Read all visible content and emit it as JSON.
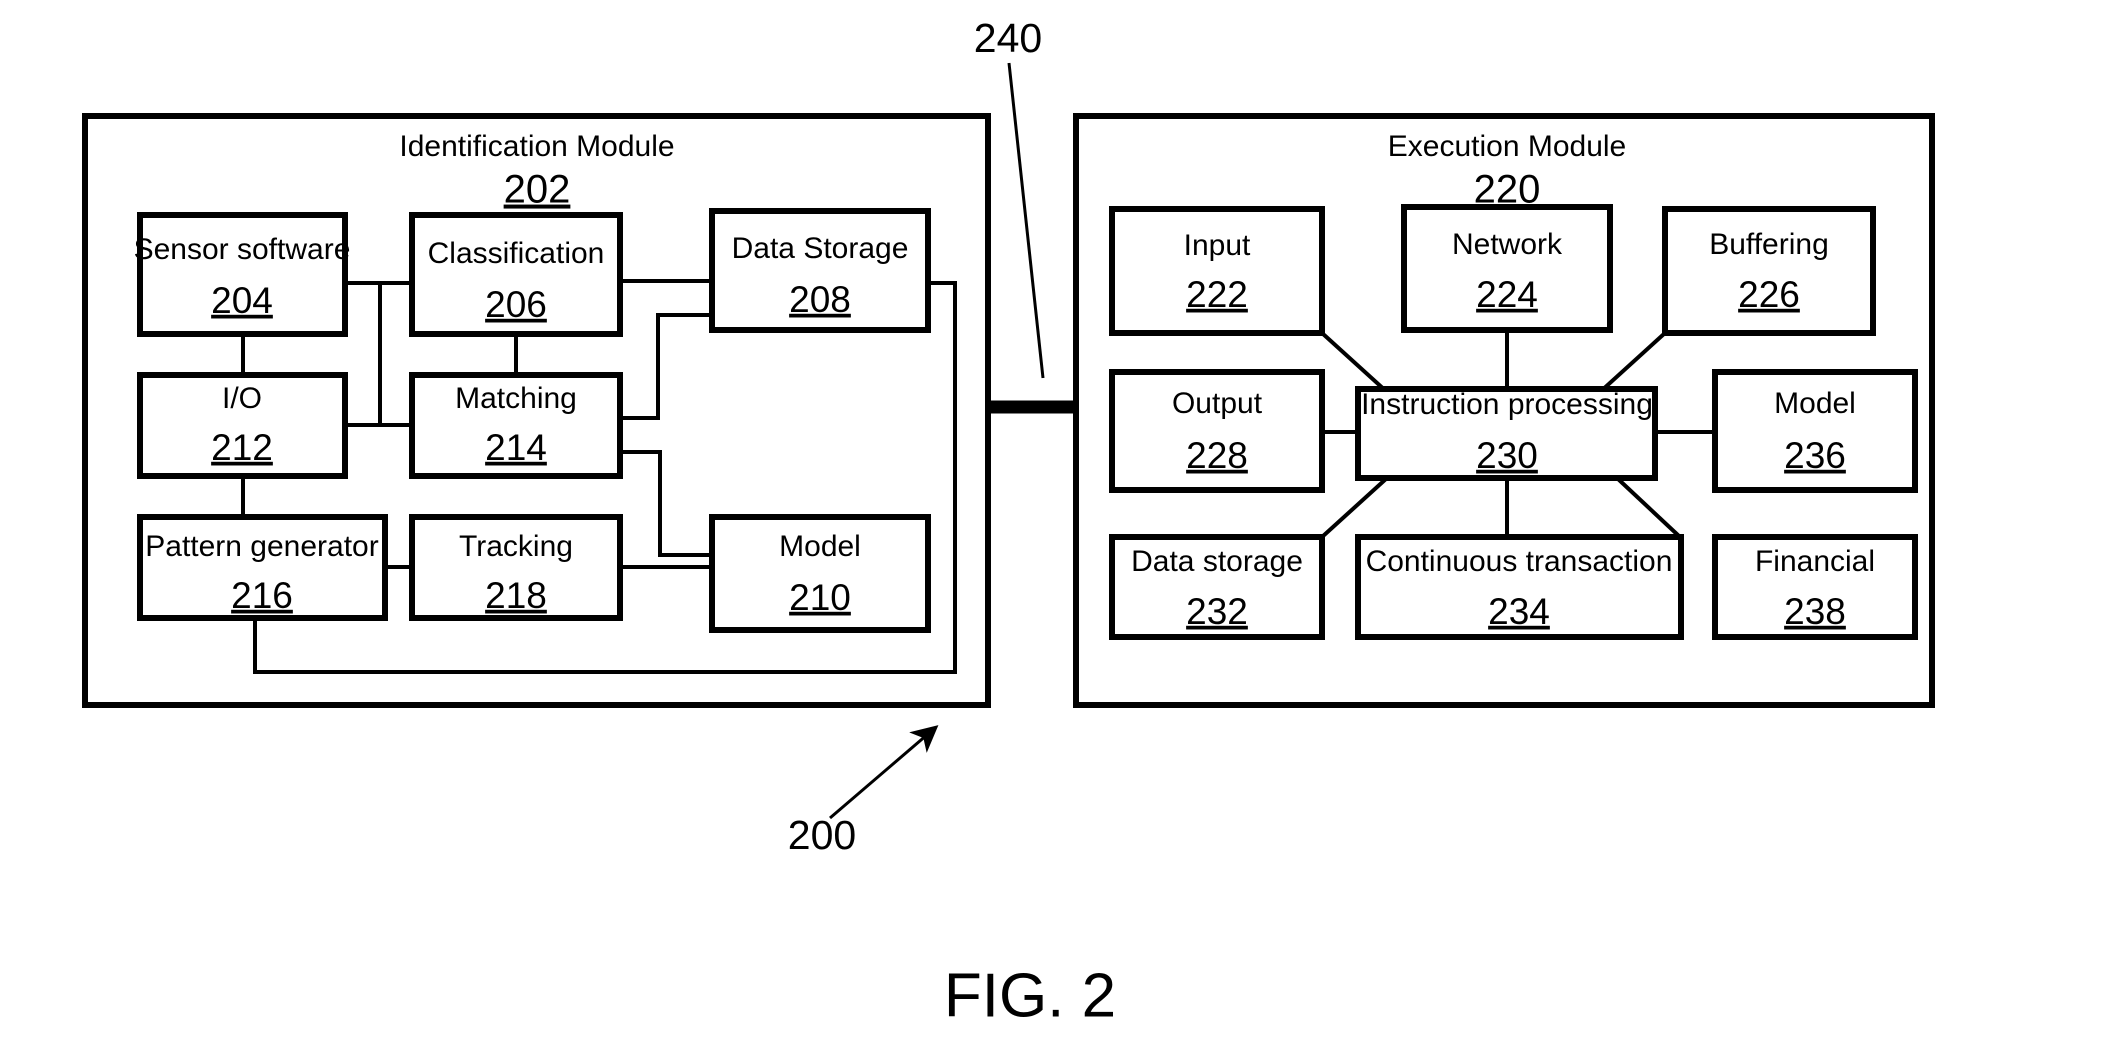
{
  "figure": {
    "caption": "FIG. 2",
    "overall_ref": "200",
    "link_ref": "240"
  },
  "modules": [
    {
      "id": "identification",
      "title": "Identification Module",
      "ref": "202",
      "nodes": [
        {
          "id": "sensor-software",
          "title": "Sensor software",
          "ref": "204"
        },
        {
          "id": "classification",
          "title": "Classification",
          "ref": "206"
        },
        {
          "id": "data-storage",
          "title": "Data Storage",
          "ref": "208"
        },
        {
          "id": "io",
          "title": "I/O",
          "ref": "212"
        },
        {
          "id": "matching",
          "title": "Matching",
          "ref": "214"
        },
        {
          "id": "pattern-generator",
          "title": "Pattern generator",
          "ref": "216"
        },
        {
          "id": "tracking",
          "title": "Tracking",
          "ref": "218"
        },
        {
          "id": "model",
          "title": "Model",
          "ref": "210"
        }
      ]
    },
    {
      "id": "execution",
      "title": "Execution Module",
      "ref": "220",
      "nodes": [
        {
          "id": "input",
          "title": "Input",
          "ref": "222"
        },
        {
          "id": "network",
          "title": "Network",
          "ref": "224"
        },
        {
          "id": "buffering",
          "title": "Buffering",
          "ref": "226"
        },
        {
          "id": "output",
          "title": "Output",
          "ref": "228"
        },
        {
          "id": "instruction-processing",
          "title": "Instruction processing",
          "ref": "230"
        },
        {
          "id": "model",
          "title": "Model",
          "ref": "236"
        },
        {
          "id": "data-storage",
          "title": "Data storage",
          "ref": "232"
        },
        {
          "id": "continuous-transaction",
          "title": "Continuous transaction",
          "ref": "234"
        },
        {
          "id": "financial",
          "title": "Financial",
          "ref": "238"
        }
      ]
    }
  ],
  "colors": {
    "ink": "#000000",
    "paper": "#ffffff"
  }
}
